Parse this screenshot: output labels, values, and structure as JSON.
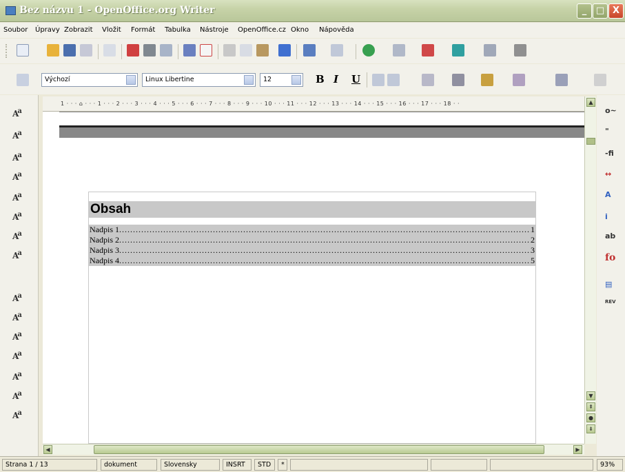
{
  "window": {
    "title": "Bez názvu 1 - OpenOffice.org Writer",
    "minimize": "_",
    "maximize": "□",
    "close": "X"
  },
  "menu": [
    "Soubor",
    "Úpravy",
    "Zobrazit",
    "Vložit",
    "Formát",
    "Tabulka",
    "Nástroje",
    "OpenOffice.cz",
    "Okno",
    "Nápověda"
  ],
  "format_bar": {
    "style": "Výchozí",
    "font": "Linux Libertine",
    "size": "12",
    "bold": "B",
    "italic": "I",
    "underline": "U"
  },
  "ruler": {
    "text": "1 · · · ⌂ · · · 1 · · · 2 · · · 3 · · · 4 · · · 5 · · · 6 · · · 7 · · · 8 · · · 9 · · · 10 · · · 11 · · · 12 · · · 13 · · · 14 · · · 15 · · · 16 · · · 17 · · · 18 · ·"
  },
  "document": {
    "toc_title": "Obsah",
    "entries": [
      {
        "label": "Nadpis 1",
        "page": "1"
      },
      {
        "label": "Nadpis 2",
        "page": "2"
      },
      {
        "label": "Nadpis 3",
        "page": "3"
      },
      {
        "label": "Nadpis 4",
        "page": "5"
      }
    ]
  },
  "status": {
    "page": "Strana 1 / 13",
    "style": "dokument",
    "language": "Slovensky",
    "insert": "INSRT",
    "selection": "STD",
    "modified": "*",
    "zoom": "93%"
  },
  "colors": {
    "titlebar": "#c7d3a8",
    "toc_shading": "#c8c8c8",
    "chrome": "#f2f1ea"
  }
}
